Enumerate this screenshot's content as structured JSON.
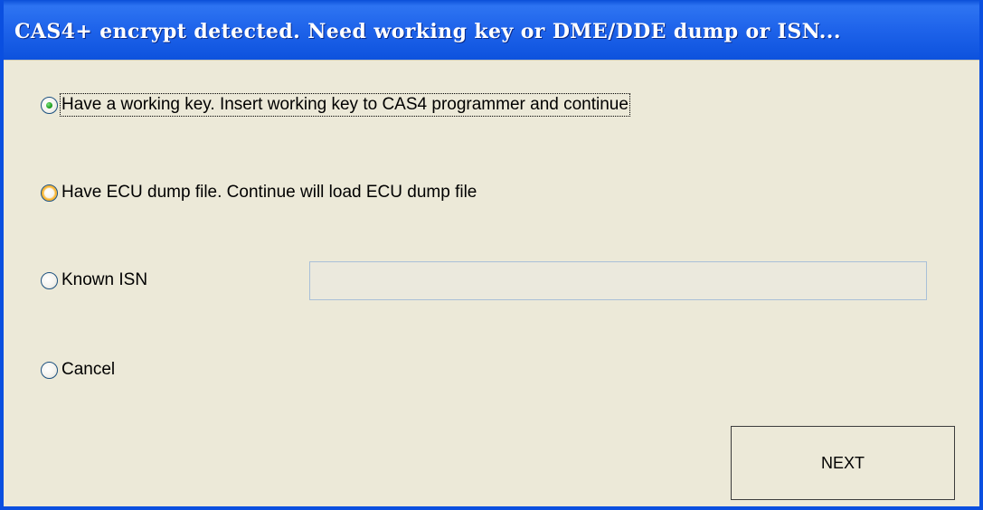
{
  "window": {
    "title": "CAS4+ encrypt detected. Need working key or DME/DDE dump or ISN..."
  },
  "options": [
    {
      "label": "Have a working key. Insert working key to CAS4 programmer and continue",
      "selected": true
    },
    {
      "label": "Have ECU dump file. Continue will load ECU dump file",
      "selected": false
    },
    {
      "label": "Known ISN",
      "selected": false
    },
    {
      "label": "Cancel",
      "selected": false
    }
  ],
  "isn_input": {
    "value": "",
    "placeholder": ""
  },
  "buttons": {
    "next_label": "NEXT"
  },
  "colors": {
    "title_bar": "#1e63ea",
    "window_bg": "#ece9d8",
    "radio_selected_dot": "#21a121",
    "radio_hover_ring": "#f8b636"
  }
}
